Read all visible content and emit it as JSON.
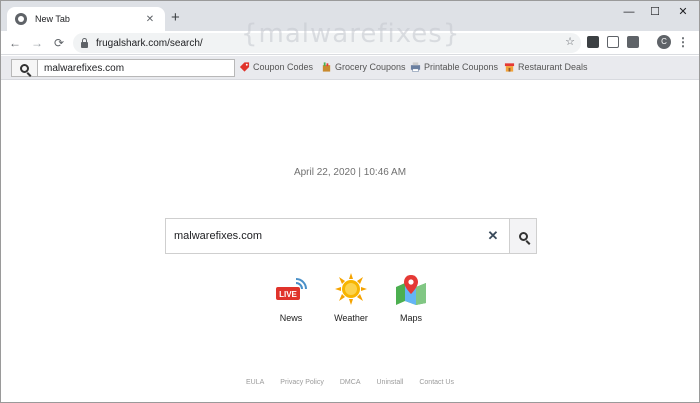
{
  "browser": {
    "tab_title": "New Tab",
    "tab_close": "✕",
    "new_tab": "+",
    "minimize": "—",
    "maximize": "☐",
    "close": "✕",
    "back": "←",
    "forward": "→",
    "reload": "⟳",
    "url": "frugalshark.com/search/",
    "bookmark_star": "☆",
    "profile_initial": "C",
    "menu": "⋮"
  },
  "watermark": "{malwarefixes}",
  "extension_bar": {
    "search_value": "malwarefixes.com",
    "links": [
      {
        "label": "Coupon Codes",
        "icon": "price-tag-icon"
      },
      {
        "label": "Grocery Coupons",
        "icon": "grocery-bag-icon"
      },
      {
        "label": "Printable Coupons",
        "icon": "printer-icon"
      },
      {
        "label": "Restaurant Deals",
        "icon": "restaurant-icon"
      }
    ]
  },
  "main": {
    "datetime": "April 22, 2020 | 10:46 AM",
    "search_value": "malwarefixes.com",
    "clear": "✕"
  },
  "shortcuts": [
    {
      "label": "News",
      "icon": "live-news-icon"
    },
    {
      "label": "Weather",
      "icon": "sun-icon"
    },
    {
      "label": "Maps",
      "icon": "map-pin-icon"
    }
  ],
  "footer": [
    "EULA",
    "Privacy Policy",
    "DMCA",
    "Uninstall",
    "Contact Us"
  ],
  "colors": {
    "live_red": "#e0332b",
    "sun": "#f5a300",
    "map_green": "#4caf50",
    "map_pin": "#e53935"
  }
}
